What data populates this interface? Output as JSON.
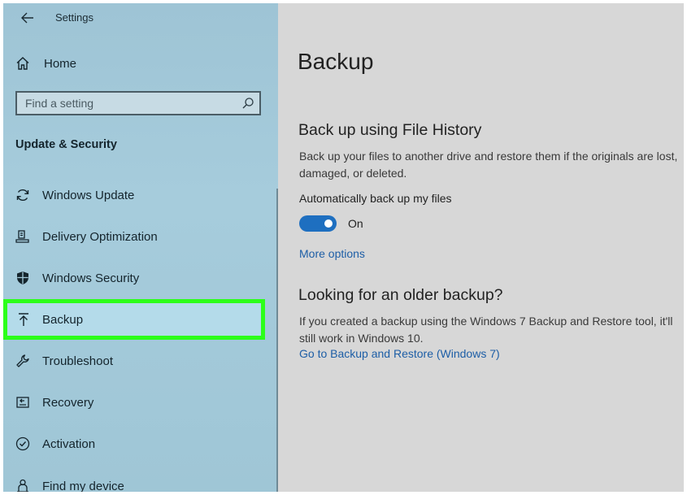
{
  "window": {
    "title": "Settings"
  },
  "sidebar": {
    "home_label": "Home",
    "search_placeholder": "Find a setting",
    "section_title": "Update & Security",
    "items": [
      {
        "label": "Windows Update",
        "icon": "sync-icon"
      },
      {
        "label": "Delivery Optimization",
        "icon": "delivery-icon"
      },
      {
        "label": "Windows Security",
        "icon": "shield-icon"
      },
      {
        "label": "Backup",
        "icon": "upload-icon",
        "selected": true
      },
      {
        "label": "Troubleshoot",
        "icon": "wrench-icon"
      },
      {
        "label": "Recovery",
        "icon": "recovery-icon"
      },
      {
        "label": "Activation",
        "icon": "check-circle-icon"
      },
      {
        "label": "Find my device",
        "icon": "person-location-icon"
      }
    ]
  },
  "main": {
    "title": "Backup",
    "file_history": {
      "heading": "Back up using File History",
      "description": "Back up your files to another drive and restore them if the originals are lost, damaged, or deleted.",
      "auto_label": "Automatically back up my files",
      "toggle_state": "On",
      "more_options": "More options"
    },
    "older_backup": {
      "heading": "Looking for an older backup?",
      "description": "If you created a backup using the Windows 7 Backup and Restore tool, it'll still work in Windows 10.",
      "link": "Go to Backup and Restore (Windows 7)"
    }
  },
  "colors": {
    "accent": "#1e6fc0",
    "highlight": "#2cff1a",
    "sidebar_bg": "#a3c9d9",
    "main_bg": "#d7d7d7"
  }
}
